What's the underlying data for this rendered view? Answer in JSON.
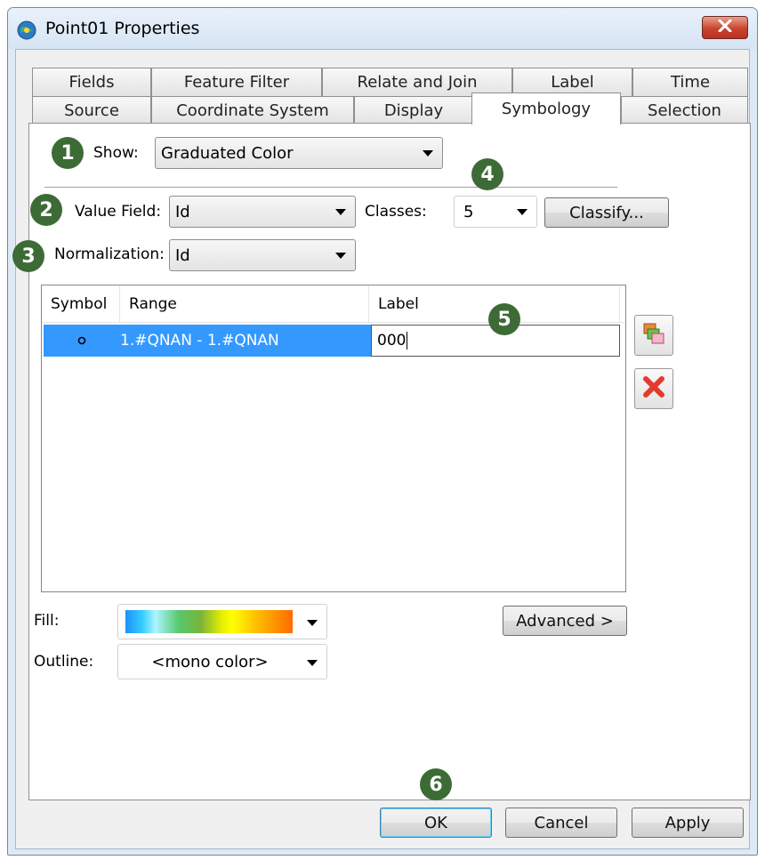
{
  "window": {
    "title": "Point01 Properties",
    "icons": {
      "app": "globe-app-icon",
      "close": "close-icon"
    }
  },
  "tabs": {
    "row1": [
      "Fields",
      "Feature Filter",
      "Relate and Join",
      "Label",
      "Time"
    ],
    "row2": [
      "Source",
      "Coordinate System",
      "Display",
      "Symbology",
      "Selection"
    ],
    "active": "Symbology"
  },
  "badges": [
    "1",
    "2",
    "3",
    "4",
    "5",
    "6"
  ],
  "symbology": {
    "show_label": "Show:",
    "show_value": "Graduated Color",
    "value_field_label": "Value Field:",
    "value_field_value": "Id",
    "classes_label": "Classes:",
    "classes_value": "5",
    "classify_label": "Classify...",
    "normalization_label": "Normalization:",
    "normalization_value": "Id"
  },
  "grid": {
    "columns": [
      "Symbol",
      "Range",
      "Label"
    ],
    "rows": [
      {
        "symbol": "o",
        "range": "1.#QNAN - 1.#QNAN",
        "label": "000"
      }
    ]
  },
  "side_buttons": {
    "add_icon": "add-classes-icon",
    "delete_icon": "delete-icon"
  },
  "fill": {
    "label": "Fill:",
    "ramp_colors": [
      "#1e90ff",
      "#33ccff",
      "#56c86a",
      "#ffff00",
      "#ff6a00"
    ]
  },
  "outline": {
    "label": "Outline:",
    "value": "<mono color>"
  },
  "advanced_label": "Advanced >",
  "footer": {
    "ok": "OK",
    "cancel": "Cancel",
    "apply": "Apply"
  },
  "colors": {
    "badge": "#3d6b35",
    "selection": "#3399ff",
    "close": "#c8442e"
  }
}
